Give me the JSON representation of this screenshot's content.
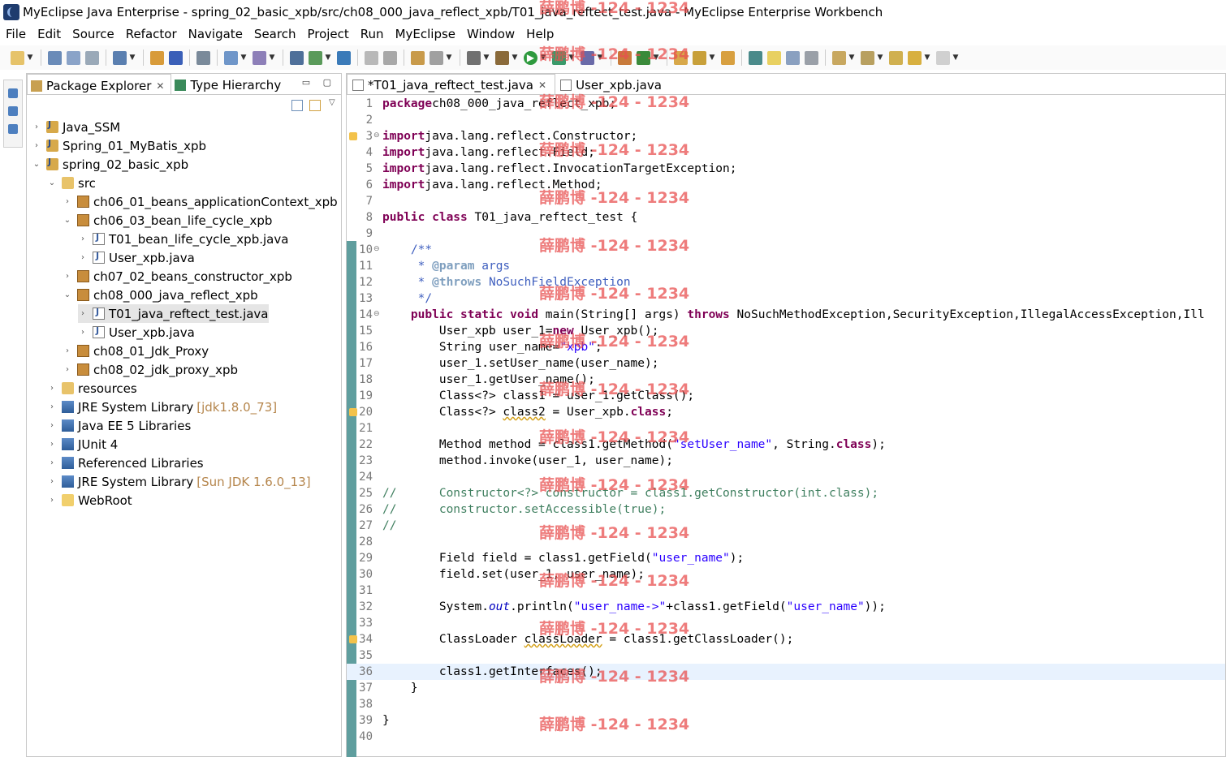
{
  "window": {
    "title": "MyEclipse Java Enterprise - spring_02_basic_xpb/src/ch08_000_java_reflect_xpb/T01_java_reftect_test.java - MyEclipse Enterprise Workbench"
  },
  "menu": [
    "File",
    "Edit",
    "Source",
    "Refactor",
    "Navigate",
    "Search",
    "Project",
    "Run",
    "MyEclipse",
    "Window",
    "Help"
  ],
  "explorer": {
    "tabs": [
      {
        "label": "Package Explorer",
        "active": true
      },
      {
        "label": "Type Hierarchy",
        "active": false
      }
    ],
    "tree": [
      {
        "label": "Java_SSM",
        "depth": 0,
        "arrow": "collapsed",
        "icon": "project"
      },
      {
        "label": "Spring_01_MyBatis_xpb",
        "depth": 0,
        "arrow": "collapsed",
        "icon": "project"
      },
      {
        "label": "spring_02_basic_xpb",
        "depth": 0,
        "arrow": "expanded",
        "icon": "project"
      },
      {
        "label": "src",
        "depth": 1,
        "arrow": "expanded",
        "icon": "srcfolder"
      },
      {
        "label": "ch06_01_beans_applicationContext_xpb",
        "depth": 2,
        "arrow": "collapsed",
        "icon": "package"
      },
      {
        "label": "ch06_03_bean_life_cycle_xpb",
        "depth": 2,
        "arrow": "expanded",
        "icon": "package"
      },
      {
        "label": "T01_bean_life_cycle_xpb.java",
        "depth": 3,
        "arrow": "collapsed",
        "icon": "javafile"
      },
      {
        "label": "User_xpb.java",
        "depth": 3,
        "arrow": "collapsed",
        "icon": "javafile"
      },
      {
        "label": "ch07_02_beans_constructor_xpb",
        "depth": 2,
        "arrow": "collapsed",
        "icon": "package"
      },
      {
        "label": "ch08_000_java_reflect_xpb",
        "depth": 2,
        "arrow": "expanded",
        "icon": "package"
      },
      {
        "label": "T01_java_reftect_test.java",
        "depth": 3,
        "arrow": "collapsed",
        "icon": "javafile",
        "selected": true
      },
      {
        "label": "User_xpb.java",
        "depth": 3,
        "arrow": "collapsed",
        "icon": "javafile"
      },
      {
        "label": "ch08_01_Jdk_Proxy",
        "depth": 2,
        "arrow": "collapsed",
        "icon": "package"
      },
      {
        "label": "ch08_02_jdk_proxy_xpb",
        "depth": 2,
        "arrow": "collapsed",
        "icon": "package"
      },
      {
        "label": "resources",
        "depth": 1,
        "arrow": "collapsed",
        "icon": "srcfolder"
      },
      {
        "label": "JRE System Library",
        "decor": "[jdk1.8.0_73]",
        "depth": 1,
        "arrow": "collapsed",
        "icon": "library"
      },
      {
        "label": "Java EE 5 Libraries",
        "depth": 1,
        "arrow": "collapsed",
        "icon": "library"
      },
      {
        "label": "JUnit 4",
        "depth": 1,
        "arrow": "collapsed",
        "icon": "library"
      },
      {
        "label": "Referenced Libraries",
        "depth": 1,
        "arrow": "collapsed",
        "icon": "library"
      },
      {
        "label": "JRE System Library",
        "decor": "[Sun JDK 1.6.0_13]",
        "depth": 1,
        "arrow": "collapsed",
        "icon": "library"
      },
      {
        "label": "WebRoot",
        "depth": 1,
        "arrow": "collapsed",
        "icon": "folder"
      }
    ]
  },
  "editor": {
    "tabs": [
      {
        "label": "*T01_java_reftect_test.java",
        "active": true
      },
      {
        "label": "User_xpb.java",
        "active": false
      }
    ],
    "current_line": 36,
    "lines": [
      [
        [
          "kw",
          "package"
        ],
        [
          "",
          "ch08_000_java_reflect_xpb;"
        ]
      ],
      [],
      [
        [
          "kw",
          "import"
        ],
        [
          "",
          "java.lang.reflect.Constructor;"
        ]
      ],
      [
        [
          "kw",
          "import"
        ],
        [
          "",
          "java.lang.reflect.Field;"
        ]
      ],
      [
        [
          "kw",
          "import"
        ],
        [
          "",
          "java.lang.reflect.InvocationTargetException;"
        ]
      ],
      [
        [
          "kw",
          "import"
        ],
        [
          "",
          "java.lang.reflect.Method;"
        ]
      ],
      [],
      [
        [
          "kw",
          "public class"
        ],
        [
          "",
          " T01_java_reftect_test {"
        ]
      ],
      [],
      [
        [
          "cmt",
          "    /**"
        ]
      ],
      [
        [
          "cmt",
          "     * "
        ],
        [
          "tag",
          "@param"
        ],
        [
          "cmt",
          " args"
        ]
      ],
      [
        [
          "cmt",
          "     * "
        ],
        [
          "tag",
          "@throws"
        ],
        [
          "cmt",
          " NoSuchFieldException"
        ]
      ],
      [
        [
          "cmt",
          "     */"
        ]
      ],
      [
        [
          "",
          "    "
        ],
        [
          "kw",
          "public static void"
        ],
        [
          "",
          " main(String[] args) "
        ],
        [
          "kw",
          "throws"
        ],
        [
          "",
          " NoSuchMethodException,SecurityException,IllegalAccessException,Ill"
        ]
      ],
      [
        [
          "",
          "        User_xpb user_1="
        ],
        [
          "kw",
          "new"
        ],
        [
          "",
          " User_xpb();"
        ]
      ],
      [
        [
          "",
          "        String user_name="
        ],
        [
          "str",
          "\"xpb\""
        ],
        [
          "",
          ";"
        ]
      ],
      [
        [
          "",
          "        user_1.setUser_name(user_name);"
        ]
      ],
      [
        [
          "",
          "        user_1.getUser_name();"
        ]
      ],
      [
        [
          "",
          "        Class<?> class1 = user_1.getClass();"
        ]
      ],
      [
        [
          "",
          "        Class<?> "
        ],
        [
          "warn",
          "class2"
        ],
        [
          "",
          " = User_xpb."
        ],
        [
          "kw",
          "class"
        ],
        [
          "",
          ";"
        ]
      ],
      [],
      [
        [
          "",
          "        Method method = class1.getMethod("
        ],
        [
          "str",
          "\"setUser_name\""
        ],
        [
          "",
          ", String."
        ],
        [
          "kw",
          "class"
        ],
        [
          "",
          ");"
        ]
      ],
      [
        [
          "",
          "        method.invoke(user_1, user_name);"
        ]
      ],
      [],
      [
        [
          "lc",
          "//      Constructor<?> constructor = class1.getConstructor(int.class);"
        ]
      ],
      [
        [
          "lc",
          "//      constructor.setAccessible(true);"
        ]
      ],
      [
        [
          "lc",
          "//"
        ]
      ],
      [],
      [
        [
          "",
          "        Field field = class1.getField("
        ],
        [
          "str",
          "\"user_name\""
        ],
        [
          "",
          ");"
        ]
      ],
      [
        [
          "",
          "        field.set(user_1, user_name);"
        ]
      ],
      [],
      [
        [
          "",
          "        System."
        ],
        [
          "fld",
          "out"
        ],
        [
          "",
          ".println("
        ],
        [
          "str",
          "\"user_name->\""
        ],
        [
          "",
          "+class1.getField("
        ],
        [
          "str",
          "\"user_name\""
        ],
        [
          "",
          "));"
        ]
      ],
      [],
      [
        [
          "",
          "        ClassLoader "
        ],
        [
          "warn",
          "classLoader"
        ],
        [
          "",
          " = class1.getClassLoader();"
        ]
      ],
      [],
      [
        [
          "",
          "        class1.getInterfaces();"
        ]
      ],
      [
        [
          "",
          "    }"
        ]
      ],
      [],
      [
        [
          "",
          "}"
        ]
      ],
      []
    ]
  },
  "watermark": "薛鹏博 -124 - 1234"
}
